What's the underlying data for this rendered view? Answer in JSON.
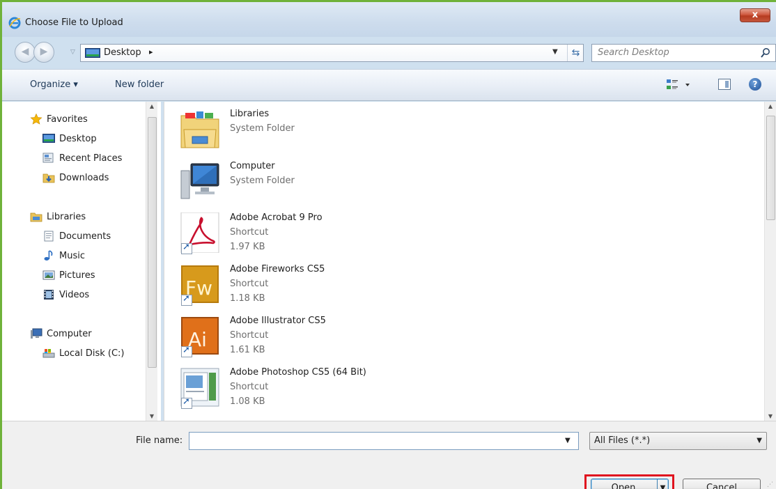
{
  "window": {
    "title": "Choose File to Upload",
    "close_label": "x"
  },
  "address": {
    "location": "Desktop",
    "chevron": "▸",
    "search_placeholder": "Search Desktop"
  },
  "toolbar": {
    "organize_label": "Organize ▾",
    "new_folder_label": "New folder",
    "help_label": "?"
  },
  "nav_pane": {
    "favorites": {
      "label": "Favorites",
      "items": [
        "Desktop",
        "Recent Places",
        "Downloads"
      ]
    },
    "libraries": {
      "label": "Libraries",
      "items": [
        "Documents",
        "Music",
        "Pictures",
        "Videos"
      ]
    },
    "computer": {
      "label": "Computer",
      "items": [
        "Local Disk (C:)"
      ]
    }
  },
  "files": [
    {
      "name": "Libraries",
      "type": "System Folder",
      "size": "",
      "icon": "libraries-folder-icon"
    },
    {
      "name": "Computer",
      "type": "System Folder",
      "size": "",
      "icon": "computer-icon"
    },
    {
      "name": "Adobe Acrobat 9 Pro",
      "type": "Shortcut",
      "size": "1.97 KB",
      "icon": "acrobat-icon"
    },
    {
      "name": "Adobe Fireworks CS5",
      "type": "Shortcut",
      "size": "1.18 KB",
      "icon": "fireworks-icon"
    },
    {
      "name": "Adobe Illustrator CS5",
      "type": "Shortcut",
      "size": "1.61 KB",
      "icon": "illustrator-icon"
    },
    {
      "name": "Adobe Photoshop CS5 (64 Bit)",
      "type": "Shortcut",
      "size": "1.08 KB",
      "icon": "photoshop-icon"
    }
  ],
  "bottom": {
    "file_name_label": "File name:",
    "file_name_value": "",
    "file_type": "All Files (*.*)",
    "open_label": "Open",
    "cancel_label": "Cancel"
  },
  "colors": {
    "highlight": "#e0141f",
    "fireworks": "#d79a1c",
    "illustrator": "#e0701a",
    "acrobat": "#c8102e"
  }
}
